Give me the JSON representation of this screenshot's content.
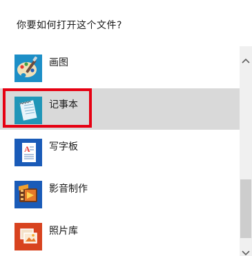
{
  "dialog": {
    "question": "你要如何打开这个文件?"
  },
  "apps": [
    {
      "label": "画图",
      "icon": "paint-icon",
      "selected": false
    },
    {
      "label": "记事本",
      "icon": "notepad-icon",
      "selected": true
    },
    {
      "label": "写字板",
      "icon": "wordpad-icon",
      "selected": false
    },
    {
      "label": "影音制作",
      "icon": "movie-maker-icon",
      "selected": false
    },
    {
      "label": "照片库",
      "icon": "photo-gallery-icon",
      "selected": false
    }
  ],
  "colors": {
    "selection_bg": "#d9d9d9",
    "highlight_border": "#e60012",
    "scrollbar_track": "#f0f0f0",
    "scrollbar_thumb": "#cdcdcd"
  }
}
